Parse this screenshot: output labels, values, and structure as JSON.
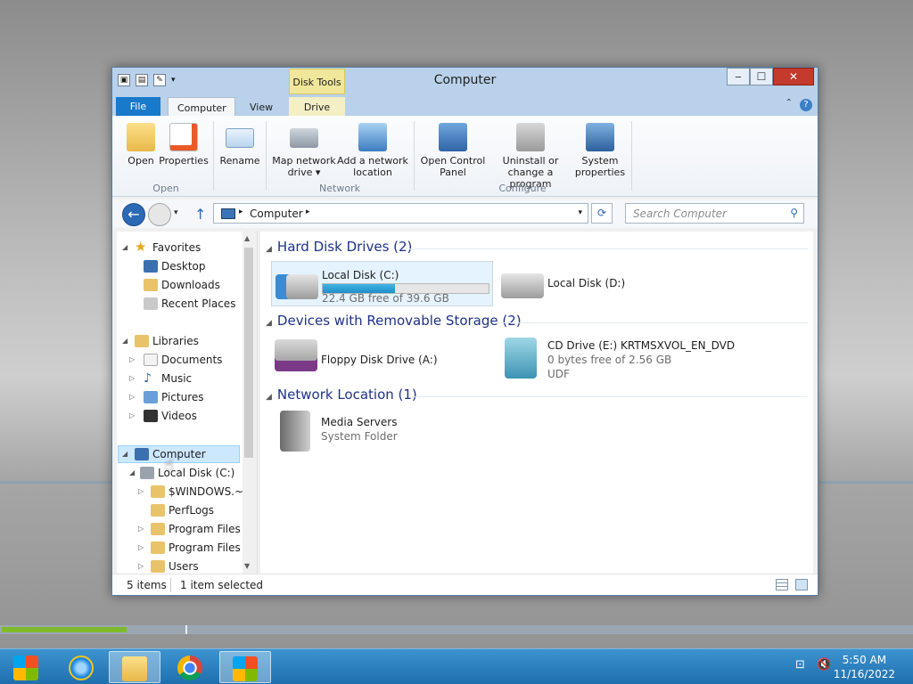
{
  "window": {
    "title": "Computer",
    "context_tab_group": "Disk Tools",
    "tabs": {
      "file": "File",
      "computer": "Computer",
      "view": "View",
      "drive": "Drive"
    },
    "controls": {
      "minimize": "‒",
      "maximize": "☐",
      "close": "✕"
    }
  },
  "ribbon": {
    "open_label": "Open",
    "properties_label": "Properties",
    "rename_label": "Rename",
    "map_drive_label_1": "Map network",
    "map_drive_label_2": "drive ▾",
    "add_location_label_1": "Add a network",
    "add_location_label_2": "location",
    "control_panel_label_1": "Open Control",
    "control_panel_label_2": "Panel",
    "uninstall_label_1": "Uninstall or",
    "uninstall_label_2": "change a program",
    "system_props_label_1": "System",
    "system_props_label_2": "properties",
    "group_open": "Open",
    "group_network": "Network",
    "group_configure": "Configure"
  },
  "navbar": {
    "breadcrumb": "Computer",
    "search_placeholder": "Search Computer"
  },
  "navpane": {
    "favorites": "Favorites",
    "desktop": "Desktop",
    "downloads": "Downloads",
    "recent": "Recent Places",
    "libraries": "Libraries",
    "documents": "Documents",
    "music": "Music",
    "pictures": "Pictures",
    "videos": "Videos",
    "computer": "Computer",
    "local_c": "Local Disk (C:)",
    "windows": "$WINDOWS.~B",
    "perflogs": "PerfLogs",
    "program_files": "Program Files",
    "program_files_x86": "Program Files (",
    "users": "Users"
  },
  "content": {
    "hdd_header": "Hard Disk Drives (2)",
    "removable_header": "Devices with Removable Storage (2)",
    "network_header": "Network Location (1)",
    "disk_c": {
      "name": "Local Disk (C:)",
      "free": "22.4 GB free of 39.6 GB",
      "used_fraction": 0.434
    },
    "disk_d": {
      "name": "Local Disk (D:)"
    },
    "floppy": {
      "name": "Floppy Disk Drive (A:)"
    },
    "cd": {
      "name": "CD Drive (E:) KRTMSXVOL_EN_DVD",
      "free": "0 bytes free of 2.56 GB",
      "fs": "UDF"
    },
    "media": {
      "name": "Media Servers",
      "type": "System Folder"
    }
  },
  "status": {
    "items": "5 items",
    "selected": "1 item selected"
  },
  "taskbar": {
    "time": "5:50 AM",
    "date": "11/16/2022"
  },
  "colors": {
    "accent": "#1979ca",
    "taskbar": "#2a7fc0",
    "selection": "#cce8ff",
    "progress": "#7fba2a",
    "header_text": "#1e3287"
  }
}
